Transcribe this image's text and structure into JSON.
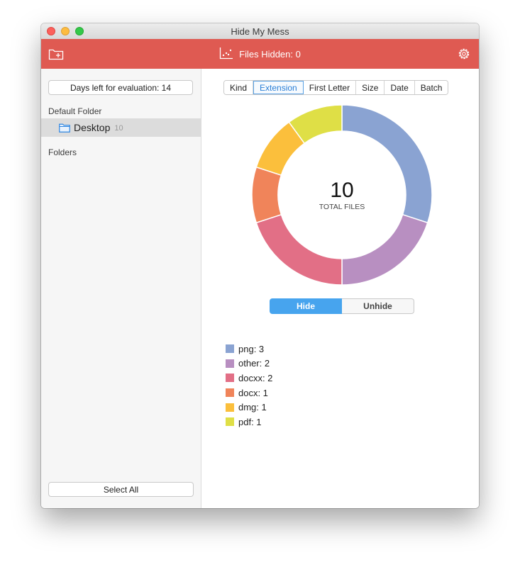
{
  "window": {
    "title": "Hide My Mess"
  },
  "toolbar": {
    "status": "Files Hidden: 0",
    "add_folder_icon": "folder-plus-icon",
    "chart_icon": "scatter-chart-icon",
    "settings_icon": "gear-icon"
  },
  "sidebar": {
    "evaluation": "Days left for evaluation: 14",
    "default_folder_heading": "Default Folder",
    "default_folder": {
      "name": "Desktop",
      "count": "10",
      "icon": "folder-icon"
    },
    "folders_heading": "Folders",
    "select_all": "Select All"
  },
  "tabs": [
    "Kind",
    "Extension",
    "First Letter",
    "Size",
    "Date",
    "Batch"
  ],
  "active_tab": "Extension",
  "center": {
    "total": "10",
    "label": "TOTAL FILES"
  },
  "actions": {
    "hide": "Hide",
    "unhide": "Unhide",
    "active": "hide"
  },
  "colors": {
    "toolbar": "#df5a52",
    "accent": "#47a4ee"
  },
  "chart_data": {
    "type": "pie",
    "style": "donut",
    "categories": [
      "png",
      "other",
      "docxx",
      "docx",
      "dmg",
      "pdf"
    ],
    "values": [
      3,
      2,
      2,
      1,
      1,
      1
    ],
    "colors": [
      "#8aa3d2",
      "#b88fc1",
      "#e26f86",
      "#f0845a",
      "#fbbf3c",
      "#dfdf46"
    ],
    "legend_labels": [
      "png: 3",
      "other: 2",
      "docxx: 2",
      "docx: 1",
      "dmg: 1",
      "pdf: 1"
    ],
    "legend_placement": "bottom-left"
  }
}
